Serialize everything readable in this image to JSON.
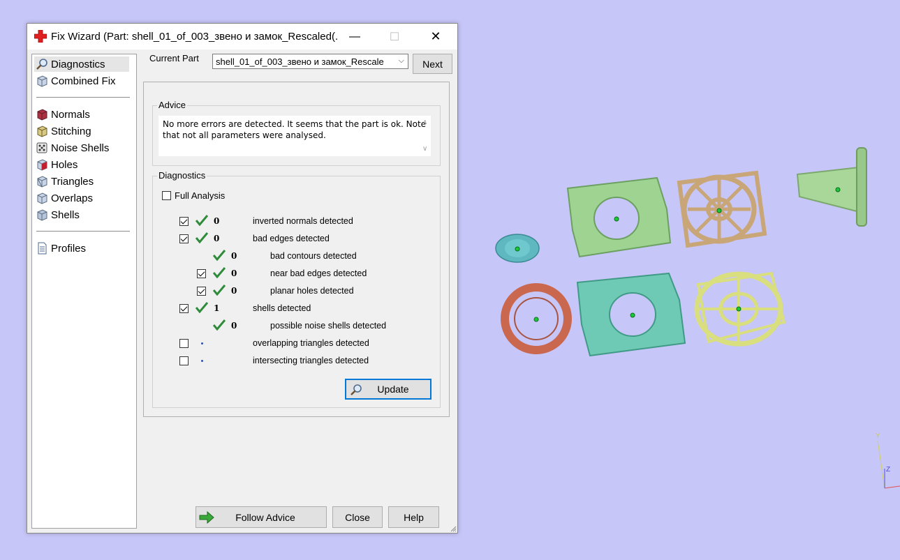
{
  "window": {
    "title": "Fix Wizard (Part: shell_01_of_003_звено и замок_Rescaled(...",
    "minimize_glyph": "—",
    "maximize_glyph": "☐",
    "close_glyph": "✕"
  },
  "sidebar": {
    "items": [
      {
        "label": "Diagnostics",
        "icon": "magnifier-icon"
      },
      {
        "label": "Combined Fix",
        "icon": "cube-icon"
      },
      {
        "label": "Normals",
        "icon": "normals-cube-icon"
      },
      {
        "label": "Stitching",
        "icon": "stitching-cube-icon"
      },
      {
        "label": "Noise Shells",
        "icon": "noise-dice-icon"
      },
      {
        "label": "Holes",
        "icon": "holes-cube-icon"
      },
      {
        "label": "Triangles",
        "icon": "triangles-cube-icon"
      },
      {
        "label": "Overlaps",
        "icon": "overlaps-cube-icon"
      },
      {
        "label": "Shells",
        "icon": "shells-cube-icon"
      },
      {
        "label": "Profiles",
        "icon": "document-icon"
      }
    ]
  },
  "current_part": {
    "label": "Current Part",
    "value": "shell_01_of_003_звено и замок_Rescale",
    "next_label": "Next"
  },
  "advice": {
    "legend": "Advice",
    "line1": "No more errors are detected. It seems that the part is ok. Note",
    "line2": "that not all parameters were analysed."
  },
  "diagnostics": {
    "legend": "Diagnostics",
    "full_analysis": "Full Analysis",
    "rows": [
      {
        "count": "0",
        "label": "inverted normals detected"
      },
      {
        "count": "0",
        "label": "bad edges detected"
      },
      {
        "count": "0",
        "label": "bad contours detected"
      },
      {
        "count": "0",
        "label": "near bad edges detected"
      },
      {
        "count": "0",
        "label": "planar holes detected"
      },
      {
        "count": "1",
        "label": "shells detected"
      },
      {
        "count": "0",
        "label": "possible noise shells detected"
      },
      {
        "count": "",
        "label": "overlapping triangles detected"
      },
      {
        "count": "",
        "label": "intersecting triangles detected"
      }
    ],
    "update_label": "Update"
  },
  "footer": {
    "follow_advice_label": "Follow Advice",
    "close_label": "Close",
    "help_label": "Help"
  },
  "axis": {
    "y": "Y",
    "z": "Z"
  },
  "colors": {
    "viewport_bg": "#c7c6f8",
    "check_green": "#2e8b3a",
    "focus_blue": "#0078d7"
  }
}
